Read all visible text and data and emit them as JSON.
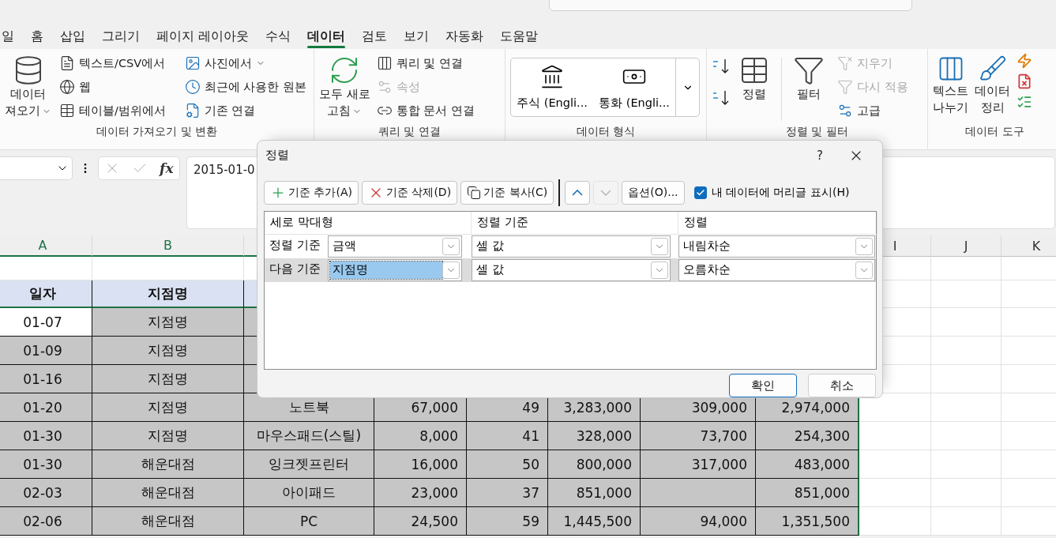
{
  "ribbon_tabs": [
    {
      "label": "일",
      "selected": false
    },
    {
      "label": "홈",
      "selected": false
    },
    {
      "label": "삽입",
      "selected": false
    },
    {
      "label": "그리기",
      "selected": false
    },
    {
      "label": "페이지 레이아웃",
      "selected": false
    },
    {
      "label": "수식",
      "selected": false
    },
    {
      "label": "데이터",
      "selected": true
    },
    {
      "label": "검토",
      "selected": false
    },
    {
      "label": "보기",
      "selected": false
    },
    {
      "label": "자동화",
      "selected": false
    },
    {
      "label": "도움말",
      "selected": false
    }
  ],
  "ribbon": {
    "get_data": {
      "label": "데이터 가져오기 및 변환",
      "large": {
        "lines": [
          "데이터",
          "져오기"
        ],
        "dropdown": true
      },
      "items": [
        {
          "label": "텍스트/CSV에서",
          "dropdown": false,
          "disabled": false
        },
        {
          "label": "웹",
          "dropdown": false,
          "disabled": false
        },
        {
          "label": "테이블/범위에서",
          "dropdown": false,
          "disabled": false
        },
        {
          "label": "사진에서",
          "dropdown": true,
          "disabled": false
        },
        {
          "label": "최근에 사용한 원본",
          "dropdown": false,
          "disabled": false
        },
        {
          "label": "기존 연결",
          "dropdown": false,
          "disabled": false
        }
      ]
    },
    "queries": {
      "label": "쿼리 및 연결",
      "large": {
        "lines": [
          "모두 새로",
          "고침"
        ],
        "dropdown": true
      },
      "items": [
        {
          "label": "쿼리 및 연결",
          "dropdown": false,
          "disabled": false
        },
        {
          "label": "속성",
          "dropdown": false,
          "disabled": true
        },
        {
          "label": "통합 문서 연결",
          "dropdown": false,
          "disabled": false
        }
      ]
    },
    "data_types": {
      "label": "데이터 형식",
      "items": [
        {
          "label": "주식 (Engli..."
        },
        {
          "label": "통화 (Engli..."
        }
      ]
    },
    "sort_filter": {
      "label": "정렬 및 필터",
      "sort": {
        "lines": [
          "정렬"
        ]
      },
      "filter": {
        "lines": [
          "필터"
        ]
      },
      "items": [
        {
          "label": "지우기",
          "dropdown": false,
          "disabled": true
        },
        {
          "label": "다시 적용",
          "dropdown": false,
          "disabled": true
        },
        {
          "label": "고급",
          "dropdown": false,
          "disabled": false
        }
      ]
    },
    "data_tools": {
      "label": "데이터 도구",
      "large": [
        {
          "lines": [
            "텍스트",
            "나누기"
          ]
        },
        {
          "lines": [
            "데이터",
            "정리"
          ]
        }
      ]
    }
  },
  "formula_bar": {
    "function_button": "fx",
    "formula": "2015-01-0"
  },
  "sheet": {
    "column_headers": {
      "a": "A",
      "b": "B",
      "i": "I",
      "j": "J",
      "k": "K"
    },
    "rows": [
      {
        "kind": "blank"
      },
      {
        "kind": "header",
        "a": "일자",
        "b": "지점명"
      },
      {
        "kind": "data",
        "selected": true,
        "active": true,
        "a": "01-07",
        "b": "지점명"
      },
      {
        "kind": "data",
        "selected": true,
        "active": false,
        "a": "01-09",
        "b": "지점명"
      },
      {
        "kind": "data",
        "selected": true,
        "active": false,
        "a": "01-16",
        "b": "지점명"
      },
      {
        "kind": "data",
        "selected": true,
        "active": false,
        "a": "01-20",
        "b": "지점명",
        "c": "노트북",
        "d": "67,000",
        "e": "49",
        "f": "3,283,000",
        "g": "309,000",
        "h": "2,974,000"
      },
      {
        "kind": "data",
        "selected": true,
        "active": false,
        "a": "01-30",
        "b": "지점명",
        "c": "마우스패드(스틸)",
        "d": "8,000",
        "e": "41",
        "f": "328,000",
        "g": "73,700",
        "h": "254,300"
      },
      {
        "kind": "data",
        "selected": true,
        "active": false,
        "a": "01-30",
        "b": "해운대점",
        "c": "잉크젯프린터",
        "d": "16,000",
        "e": "50",
        "f": "800,000",
        "g": "317,000",
        "h": "483,000"
      },
      {
        "kind": "data",
        "selected": true,
        "active": false,
        "a": "02-03",
        "b": "해운대점",
        "c": "아이패드",
        "d": "23,000",
        "e": "37",
        "f": "851,000",
        "h": "851,000"
      },
      {
        "kind": "data",
        "selected": true,
        "active": false,
        "a": "02-06",
        "b": "해운대점",
        "c": "PC",
        "d": "24,500",
        "e": "59",
        "f": "1,445,500",
        "g": "94,000",
        "h": "1,351,500"
      }
    ]
  },
  "dialog": {
    "title": "정렬",
    "help": "?",
    "toolbar": [
      {
        "kind": "add",
        "label": "기준 추가(A)",
        "disabled": false
      },
      {
        "kind": "delete",
        "label": "기준 삭제(D)",
        "disabled": false
      },
      {
        "kind": "copy",
        "label": "기준 복사(C)",
        "disabled": false
      },
      {
        "kind": "up",
        "disabled": false
      },
      {
        "kind": "down",
        "disabled": true
      },
      {
        "kind": "text",
        "label": "옵션(O)...",
        "disabled": false
      }
    ],
    "header_option": {
      "label": "내 데이터에 머리글 표시(H)",
      "checked": true
    },
    "columns": [
      "세로 막대형",
      "정렬 기준",
      "정렬"
    ],
    "levels": [
      {
        "label": "정렬 기준",
        "column": "금액",
        "sort_on": "셀 값",
        "order": "내림차순",
        "selected": false
      },
      {
        "label": "다음 기준",
        "column": "지점명",
        "sort_on": "셀 값",
        "order": "오름차순",
        "selected": true
      }
    ],
    "buttons": [
      {
        "label": "확인",
        "default": true
      },
      {
        "label": "취소",
        "default": false
      }
    ]
  }
}
